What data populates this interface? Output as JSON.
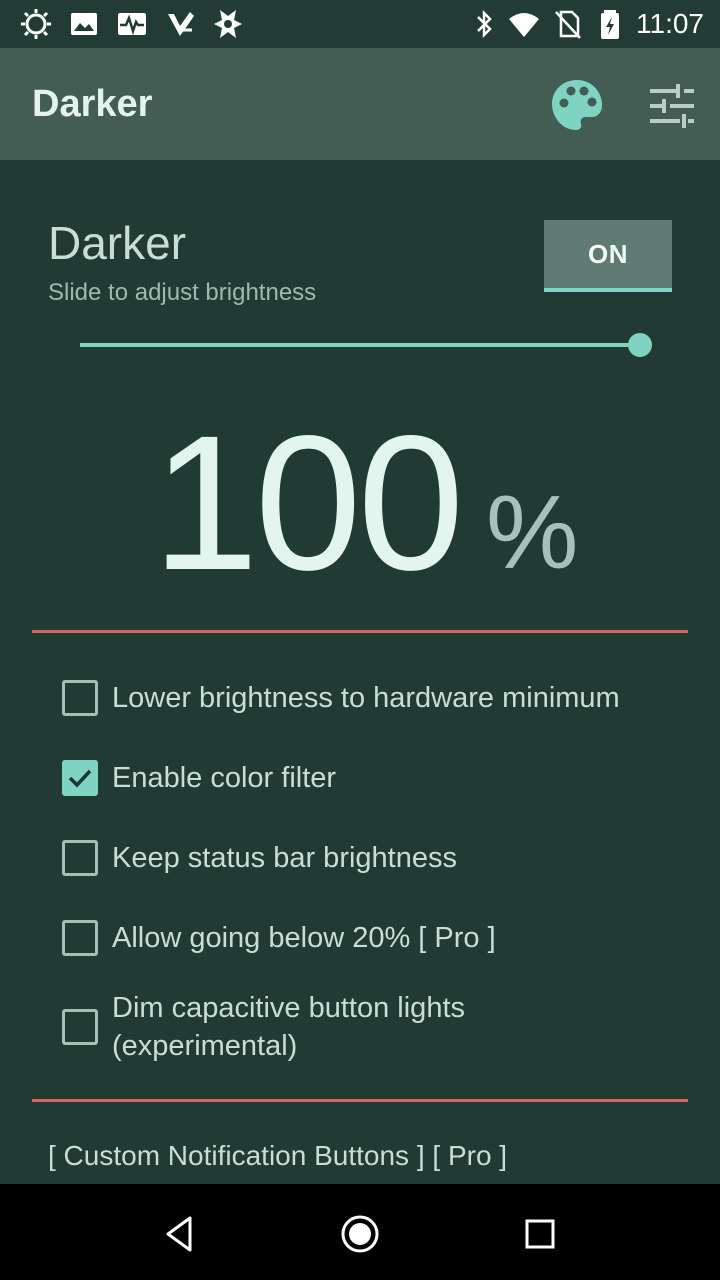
{
  "status_bar": {
    "time": "11:07",
    "left_icons": [
      "brightness-notification-icon",
      "image-notification-icon",
      "activity-notification-icon",
      "task-check-notification-icon",
      "assistant-notification-icon"
    ],
    "right_icons": [
      "bluetooth-icon",
      "wifi-icon",
      "no-sim-icon",
      "battery-charging-icon"
    ]
  },
  "app_bar": {
    "title": "Darker",
    "actions": [
      "palette-icon",
      "tune-icon"
    ]
  },
  "main": {
    "title": "Darker",
    "subtitle": "Slide to adjust brightness",
    "toggle_label": "ON",
    "slider_value_percent": 100,
    "value": "100",
    "unit": "%"
  },
  "options": [
    {
      "label": "Lower brightness to hardware minimum",
      "checked": false
    },
    {
      "label": "Enable color filter",
      "checked": true
    },
    {
      "label": "Keep status bar brightness",
      "checked": false
    },
    {
      "label": "Allow going below 20% [ Pro ]",
      "checked": false
    },
    {
      "label": "Dim capacitive button lights (experimental)",
      "checked": false
    }
  ],
  "footer_link": "[ Custom Notification Buttons ] [ Pro ]",
  "colors": {
    "background": "#213a33",
    "app_bar": "#435d55",
    "accent": "#7fd3c1",
    "divider": "#d46462",
    "toggle": "#5f7b73"
  },
  "nav_bar": [
    "back-icon",
    "home-icon",
    "recents-icon"
  ]
}
